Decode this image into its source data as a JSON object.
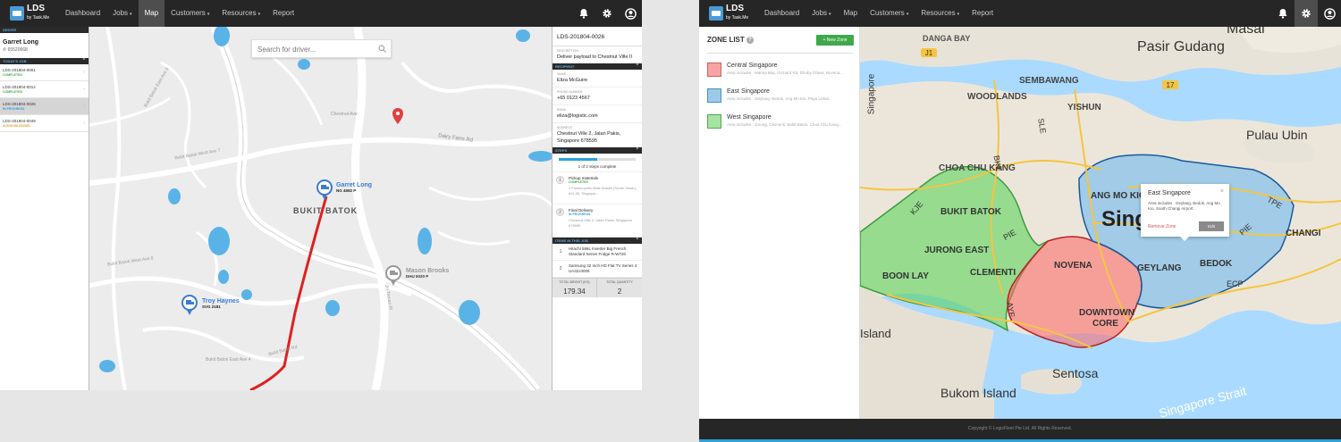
{
  "colors": {
    "accent": "#2da0e0",
    "nav_bg": "#262626",
    "completed": "#3fa84a",
    "in_progress": "#2da0e0",
    "acknowledged": "#e0a030",
    "route": "#e02020",
    "central_zone": "#f08080",
    "east_zone": "#7fb8e0",
    "west_zone": "#8ad88a"
  },
  "brand": {
    "name": "LDS",
    "tagline": "by Task.Me"
  },
  "nav": {
    "items": [
      {
        "label": "Dashboard"
      },
      {
        "label": "Jobs",
        "caret": "▾"
      },
      {
        "label": "Map"
      },
      {
        "label": "Customers",
        "caret": "▾"
      },
      {
        "label": "Resources",
        "caret": "▾"
      },
      {
        "label": "Report"
      }
    ]
  },
  "nav_icons": [
    "bell-icon",
    "gear-icon",
    "user-icon"
  ],
  "left": {
    "driver_header": "DRIVER",
    "driver_name": "Garret Long",
    "driver_phone": "65520668",
    "jobs_header": "TODAY'S JOB",
    "jobs": [
      {
        "id": "LDS-201804-0001",
        "status": "COMPLETED"
      },
      {
        "id": "LDS-201804-0014",
        "status": "COMPLETED"
      },
      {
        "id": "LDS-201804-0026",
        "status": "IN PROGRESS"
      },
      {
        "id": "LDS-201804-0049",
        "status": "ACKNOWLEDGED"
      }
    ]
  },
  "map1": {
    "search_placeholder": "Search for driver...",
    "labels": {
      "dairy_farm": "Dairy Farm Rd",
      "bukit_batok": "BUKIT BATOK",
      "bb_east5": "Bukit Batok East Ave 5",
      "bb_east2": "Bukit Batok East Ave 2",
      "bb_west7": "Bukit Batok West Ave 7",
      "bb_west8": "Bukit Batok West Ave 8",
      "bb_east4": "Bukit Batok East Ave 4",
      "chestnut": "Chestnut Ave",
      "bb_rd": "Bukit Batok Rd",
      "jalan_tenteram": "Jln Teman Ri"
    },
    "drivers": [
      {
        "name": "Garret Long",
        "plate": "NG 4592 P"
      },
      {
        "name": "Mason Brooks",
        "plate": "DHU 5020 P"
      },
      {
        "name": "Troy Haynes",
        "plate": "SVG 2181"
      }
    ]
  },
  "right": {
    "job_id": "LDS-201804-0026",
    "description_label": "DESCRIPTION",
    "description": "Deliver payload to Chestnut Ville II",
    "recipient_header": "RECIPIENT",
    "name_label": "NAME",
    "name": "Eliza McGuire",
    "phone_label": "PHONE NUMBER",
    "phone": "+65 0123 4567",
    "email_label": "EMAIL",
    "email": "eliza@logistic.com",
    "address_label": "ADDRESS",
    "address": "Chestnut Ville 2, Jalan Pakis, Singapore 678595",
    "steps_header": "STEPS",
    "progress_fraction": 0.5,
    "progress_text": "1 of 2 steps complete",
    "steps": [
      {
        "num": "1",
        "title": "Pickup materials",
        "status": "COMPLETED",
        "address": "1 Fusionopolis Walk Solaris (South Tower), #11-05, Singapor..."
      },
      {
        "num": "2",
        "title": "Final Delivery",
        "status": "IN PROGRESS",
        "address": "Chestnut Ville 2, Jalan Pakis, Singapore 678595"
      }
    ],
    "items_header": "ITEMS IN THIS JOB",
    "items": [
      {
        "num": "1",
        "name": "Hitachi 586L Inverter Big French Standard Series Fridge R-W720"
      },
      {
        "num": "2",
        "name": "Samsung 32 Inch HD Flat TV Series 4 UA32J4005"
      }
    ],
    "total_weight_label": "TOTAL WEIGHT (KG)",
    "total_weight": "179.34",
    "total_qty_label": "TOTAL QUANTITY",
    "total_qty": "2"
  },
  "zones": {
    "title": "ZONE LIST",
    "help": "?",
    "new_zone": "+ New Zone",
    "list": [
      {
        "name": "Central Singapore",
        "areas": "Area includes : Marina Bay, Orchard Rd, Dhoby Ghaut, Novena..."
      },
      {
        "name": "East Singapore",
        "areas": "Area includes : Geylang, Bedok, Ang Mo Kio, Paya Lebar..."
      },
      {
        "name": "West Singapore",
        "areas": "Area includes : Jurong, Clementi, Bukit Batok, Chua Chu Kang..."
      }
    ]
  },
  "map2": {
    "labels": {
      "danga_bay": "DANGA BAY",
      "masai": "Masai",
      "pasir_gudang": "Pasir Gudang",
      "sembawang": "SEMBAWANG",
      "woodlands": "WOODLANDS",
      "yishun": "YISHUN",
      "pulau_ubin": "Pulau Ubin",
      "singapore": "Singapore",
      "choa_chu_kang": "CHOA CHU KANG",
      "bukit_batok": "BUKIT BATOK",
      "ang_mo_kio": "ANG MO KIO",
      "jurong_east": "JURONG EAST",
      "clementi": "CLEMENTI",
      "boon_lay": "BOON LAY",
      "novena": "NOVENA",
      "geylang": "GEYLANG",
      "bedok": "BEDOK",
      "changi": "CHANGI",
      "downtown": "DOWNTOWN",
      "core": "CORE",
      "sentosa": "Sentosa",
      "bukom": "Bukom Island",
      "strait": "Singapore Strait",
      "island": "Island",
      "road_j1": "J1",
      "road_17": "17",
      "road_sle": "SLE",
      "road_bke": "BKE",
      "road_kje": "KJE",
      "road_pie": "PIE",
      "road_tpe": "TPE",
      "road_ecp": "ECP",
      "road_aye": "AYE",
      "road_pie2": "PIE",
      "singapore_left": "Singapore"
    }
  },
  "popup": {
    "title": "East Singapore",
    "body": "Area includes : Geylang, Bedok, Ang Mo Kio, South Changi Airport.",
    "remove": "Remove Zone",
    "edit": "Edit",
    "close": "×"
  },
  "footer": {
    "text": "Copyright © LogisFleet Pte Ltd. All Rights Reserved."
  }
}
